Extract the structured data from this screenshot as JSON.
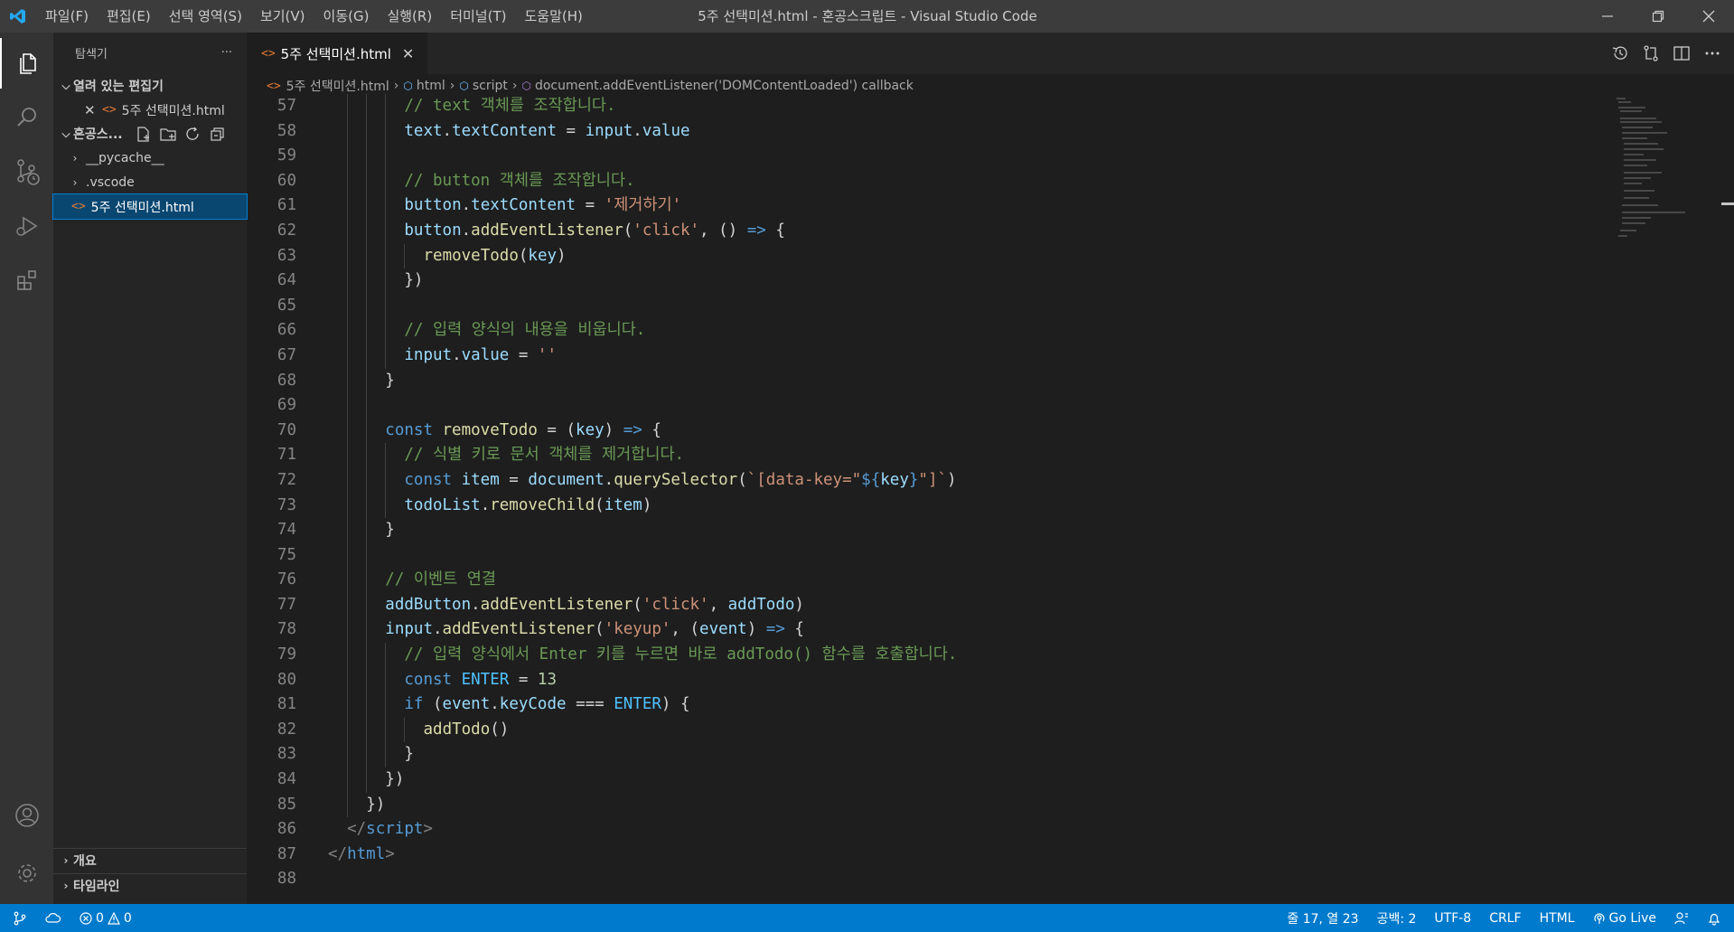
{
  "window": {
    "title": "5주 선택미션.html - 혼공스크립트 - Visual Studio Code",
    "menu": [
      "파일(F)",
      "편집(E)",
      "선택 영역(S)",
      "보기(V)",
      "이동(G)",
      "실행(R)",
      "터미널(T)",
      "도움말(H)"
    ]
  },
  "sidebar": {
    "title": "탐색기",
    "more": "···",
    "open_editors_label": "열려 있는 편집기",
    "open_editor_file": "5주 선택미션.html",
    "folder_label": "혼공스...",
    "tree": [
      {
        "label": "__pycache__",
        "type": "folder"
      },
      {
        "label": ".vscode",
        "type": "folder"
      },
      {
        "label": "5주 선택미션.html",
        "type": "file",
        "selected": true
      }
    ],
    "outline_label": "개요",
    "timeline_label": "타임라인"
  },
  "tab": {
    "label": "5주 선택미션.html"
  },
  "breadcrumb": [
    "5주 선택미션.html",
    "html",
    "script",
    "document.addEventListener('DOMContentLoaded') callback"
  ],
  "editor": {
    "lines": [
      {
        "n": "57",
        "indent": 4,
        "tokens": [
          [
            "cmt",
            "// text 객체를 조작합니다."
          ]
        ]
      },
      {
        "n": "58",
        "indent": 4,
        "tokens": [
          [
            "var",
            "text"
          ],
          [
            "p",
            "."
          ],
          [
            "var",
            "textContent"
          ],
          [
            "p",
            " = "
          ],
          [
            "var",
            "input"
          ],
          [
            "p",
            "."
          ],
          [
            "var",
            "value"
          ]
        ]
      },
      {
        "n": "59",
        "indent": 4,
        "tokens": []
      },
      {
        "n": "60",
        "indent": 4,
        "tokens": [
          [
            "cmt",
            "// button 객체를 조작합니다."
          ]
        ]
      },
      {
        "n": "61",
        "indent": 4,
        "tokens": [
          [
            "var",
            "button"
          ],
          [
            "p",
            "."
          ],
          [
            "var",
            "textContent"
          ],
          [
            "p",
            " = "
          ],
          [
            "str",
            "'제거하기'"
          ]
        ]
      },
      {
        "n": "62",
        "indent": 4,
        "tokens": [
          [
            "var",
            "button"
          ],
          [
            "p",
            "."
          ],
          [
            "fn",
            "addEventListener"
          ],
          [
            "p",
            "("
          ],
          [
            "str",
            "'click'"
          ],
          [
            "p",
            ", () "
          ],
          [
            "kw",
            "=>"
          ],
          [
            "p",
            " {"
          ]
        ]
      },
      {
        "n": "63",
        "indent": 5,
        "tokens": [
          [
            "fn",
            "removeTodo"
          ],
          [
            "p",
            "("
          ],
          [
            "var",
            "key"
          ],
          [
            "p",
            ")"
          ]
        ]
      },
      {
        "n": "64",
        "indent": 4,
        "tokens": [
          [
            "p",
            "})"
          ]
        ]
      },
      {
        "n": "65",
        "indent": 4,
        "tokens": []
      },
      {
        "n": "66",
        "indent": 4,
        "tokens": [
          [
            "cmt",
            "// 입력 양식의 내용을 비웁니다."
          ]
        ]
      },
      {
        "n": "67",
        "indent": 4,
        "tokens": [
          [
            "var",
            "input"
          ],
          [
            "p",
            "."
          ],
          [
            "var",
            "value"
          ],
          [
            "p",
            " = "
          ],
          [
            "str",
            "''"
          ]
        ]
      },
      {
        "n": "68",
        "indent": 3,
        "tokens": [
          [
            "p",
            "}"
          ]
        ]
      },
      {
        "n": "69",
        "indent": 3,
        "tokens": []
      },
      {
        "n": "70",
        "indent": 3,
        "tokens": [
          [
            "kw",
            "const "
          ],
          [
            "fn",
            "removeTodo"
          ],
          [
            "p",
            " = ("
          ],
          [
            "var",
            "key"
          ],
          [
            "p",
            ") "
          ],
          [
            "kw",
            "=>"
          ],
          [
            "p",
            " {"
          ]
        ]
      },
      {
        "n": "71",
        "indent": 4,
        "tokens": [
          [
            "cmt",
            "// 식별 키로 문서 객체를 제거합니다."
          ]
        ]
      },
      {
        "n": "72",
        "indent": 4,
        "tokens": [
          [
            "kw",
            "const "
          ],
          [
            "var",
            "item"
          ],
          [
            "p",
            " = "
          ],
          [
            "var",
            "document"
          ],
          [
            "p",
            "."
          ],
          [
            "fn",
            "querySelector"
          ],
          [
            "p",
            "("
          ],
          [
            "str",
            "`[data-key=\""
          ],
          [
            "ph",
            "${"
          ],
          [
            "var",
            "key"
          ],
          [
            "ph",
            "}"
          ],
          [
            "str",
            "\"]`"
          ],
          [
            "p",
            ")"
          ]
        ]
      },
      {
        "n": "73",
        "indent": 4,
        "tokens": [
          [
            "var",
            "todoList"
          ],
          [
            "p",
            "."
          ],
          [
            "fn",
            "removeChild"
          ],
          [
            "p",
            "("
          ],
          [
            "var",
            "item"
          ],
          [
            "p",
            ")"
          ]
        ]
      },
      {
        "n": "74",
        "indent": 3,
        "tokens": [
          [
            "p",
            "}"
          ]
        ]
      },
      {
        "n": "75",
        "indent": 3,
        "tokens": []
      },
      {
        "n": "76",
        "indent": 3,
        "tokens": [
          [
            "cmt",
            "// 이벤트 연결"
          ]
        ]
      },
      {
        "n": "77",
        "indent": 3,
        "tokens": [
          [
            "var",
            "addButton"
          ],
          [
            "p",
            "."
          ],
          [
            "fn",
            "addEventListener"
          ],
          [
            "p",
            "("
          ],
          [
            "str",
            "'click'"
          ],
          [
            "p",
            ", "
          ],
          [
            "var",
            "addTodo"
          ],
          [
            "p",
            ")"
          ]
        ]
      },
      {
        "n": "78",
        "indent": 3,
        "tokens": [
          [
            "var",
            "input"
          ],
          [
            "p",
            "."
          ],
          [
            "fn",
            "addEventListener"
          ],
          [
            "p",
            "("
          ],
          [
            "str",
            "'keyup'"
          ],
          [
            "p",
            ", ("
          ],
          [
            "var",
            "event"
          ],
          [
            "p",
            ") "
          ],
          [
            "kw",
            "=>"
          ],
          [
            "p",
            " {"
          ]
        ]
      },
      {
        "n": "79",
        "indent": 4,
        "tokens": [
          [
            "cmt",
            "// 입력 양식에서 Enter 키를 누르면 바로 addTodo() 함수를 호출합니다."
          ]
        ]
      },
      {
        "n": "80",
        "indent": 4,
        "tokens": [
          [
            "kw",
            "const "
          ],
          [
            "cst",
            "ENTER"
          ],
          [
            "p",
            " = "
          ],
          [
            "num",
            "13"
          ]
        ]
      },
      {
        "n": "81",
        "indent": 4,
        "tokens": [
          [
            "kw",
            "if"
          ],
          [
            "p",
            " ("
          ],
          [
            "var",
            "event"
          ],
          [
            "p",
            "."
          ],
          [
            "var",
            "keyCode"
          ],
          [
            "p",
            " === "
          ],
          [
            "cst",
            "ENTER"
          ],
          [
            "p",
            ") {"
          ]
        ]
      },
      {
        "n": "82",
        "indent": 5,
        "tokens": [
          [
            "fn",
            "addTodo"
          ],
          [
            "p",
            "()"
          ]
        ]
      },
      {
        "n": "83",
        "indent": 4,
        "tokens": [
          [
            "p",
            "}"
          ]
        ]
      },
      {
        "n": "84",
        "indent": 3,
        "tokens": [
          [
            "p",
            "})"
          ]
        ]
      },
      {
        "n": "85",
        "indent": 2,
        "tokens": [
          [
            "p",
            "})"
          ]
        ]
      },
      {
        "n": "86",
        "indent": 1,
        "tokens": [
          [
            "tagp",
            "</"
          ],
          [
            "tag",
            "script"
          ],
          [
            "tagp",
            ">"
          ]
        ]
      },
      {
        "n": "87",
        "indent": 0,
        "tokens": [
          [
            "tagp",
            "</"
          ],
          [
            "tag",
            "html"
          ],
          [
            "tagp",
            ">"
          ]
        ]
      },
      {
        "n": "88",
        "indent": 0,
        "tokens": []
      }
    ]
  },
  "statusbar": {
    "errors": "0",
    "warnings": "0",
    "position": "줄 17, 열 23",
    "spaces": "공백: 2",
    "encoding": "UTF-8",
    "eol": "CRLF",
    "language": "HTML",
    "golive": "Go Live"
  },
  "colors": {
    "accent": "#007acc",
    "keyword": "#569cd6",
    "variable": "#9cdcfe",
    "function": "#dcdcaa",
    "string": "#ce9178",
    "comment": "#6a9955"
  }
}
